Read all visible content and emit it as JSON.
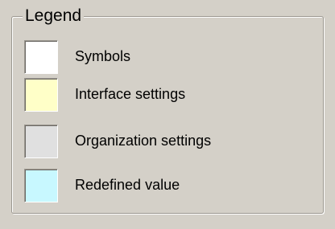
{
  "legend": {
    "title": "Legend",
    "items": [
      {
        "label": "Symbols",
        "color": "#ffffff"
      },
      {
        "label": "Interface settings",
        "color": "#ffffc8"
      },
      {
        "label": "Organization settings",
        "color": "#e0e0e0"
      },
      {
        "label": "Redefined value",
        "color": "#c8f8ff"
      }
    ]
  }
}
